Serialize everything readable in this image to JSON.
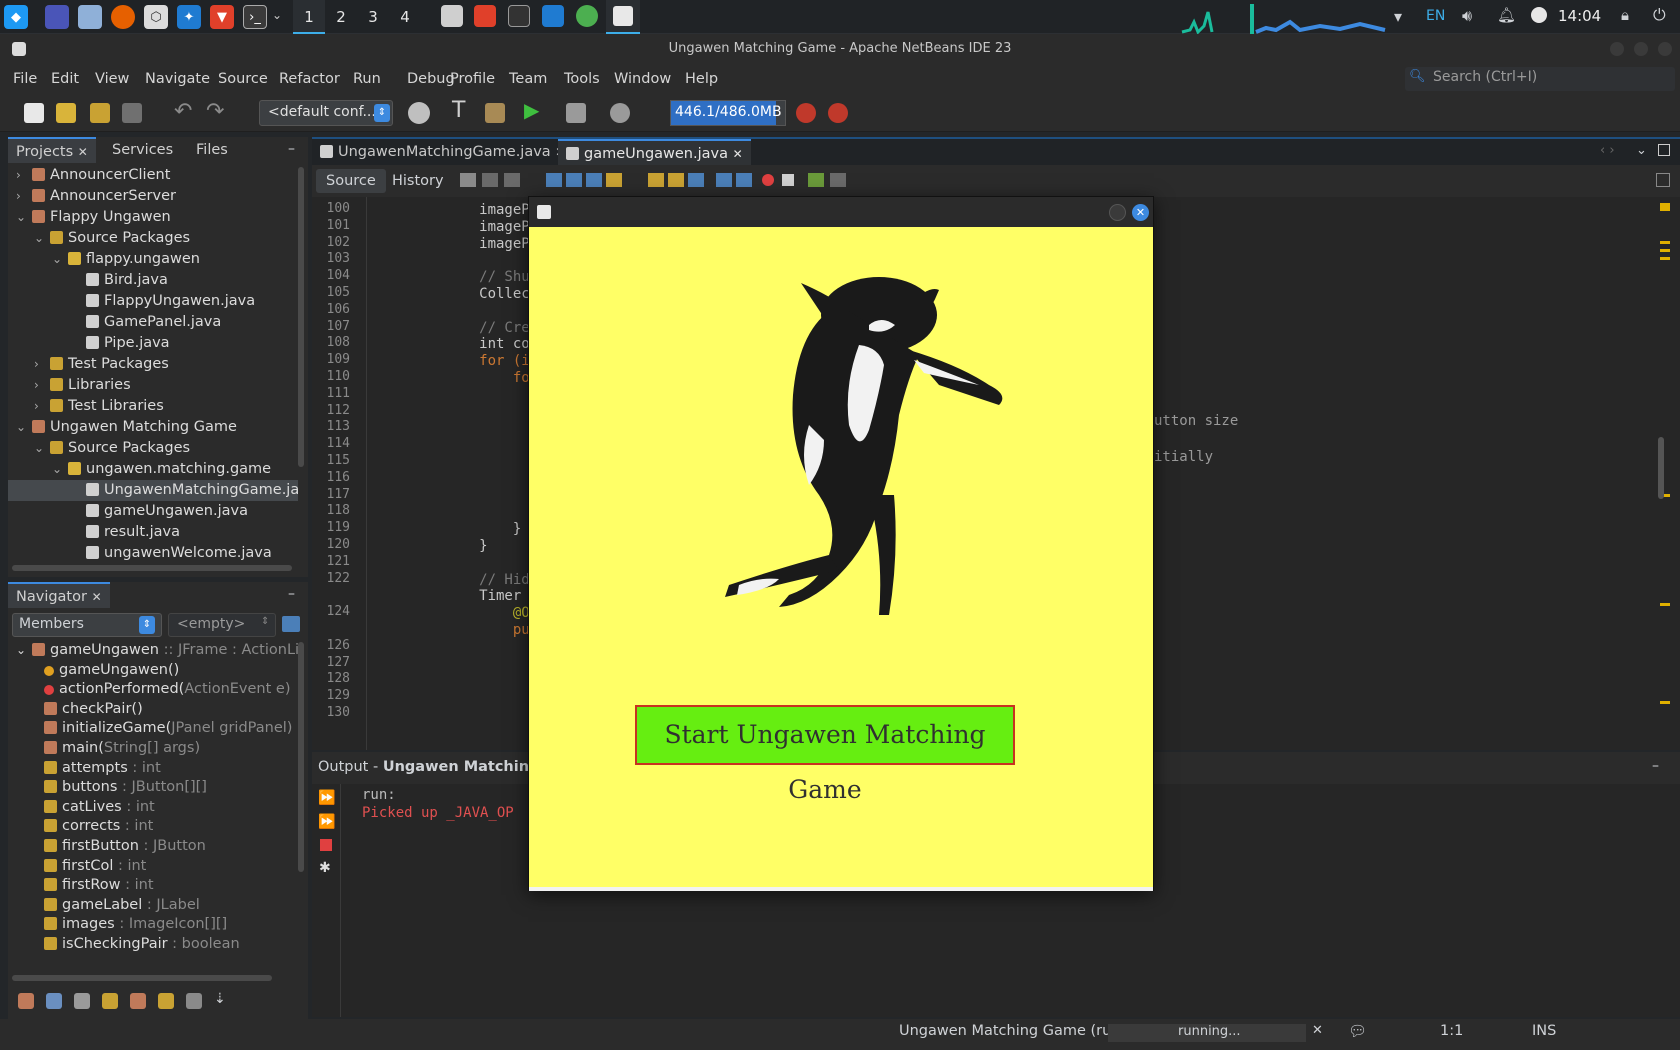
{
  "taskbar": {
    "workspaces": [
      "1",
      "2",
      "3",
      "4"
    ],
    "lang": "EN",
    "clock": "14:04"
  },
  "window": {
    "title": "Ungawen Matching Game - Apache NetBeans IDE 23"
  },
  "menu": [
    "File",
    "Edit",
    "View",
    "Navigate",
    "Source",
    "Refactor",
    "Run",
    "Debug",
    "Profile",
    "Team",
    "Tools",
    "Window",
    "Help"
  ],
  "search": {
    "placeholder": "Search (Ctrl+I)"
  },
  "toolbar": {
    "config": "<default conf...",
    "memory": "446.1/486.0MB",
    "memory_fraction": 0.918
  },
  "projects": {
    "tabs": [
      "Projects",
      "Services",
      "Files"
    ],
    "rows": [
      {
        "label": "AnnouncerClient",
        "level": 0,
        "arrow": "›",
        "icon": "project"
      },
      {
        "label": "AnnouncerServer",
        "level": 0,
        "arrow": "›",
        "icon": "project"
      },
      {
        "label": "Flappy Ungawen",
        "level": 0,
        "arrow": "⌄",
        "icon": "project"
      },
      {
        "label": "Source Packages",
        "level": 1,
        "arrow": "⌄",
        "icon": "folder"
      },
      {
        "label": "flappy.ungawen",
        "level": 2,
        "arrow": "⌄",
        "icon": "package"
      },
      {
        "label": "Bird.java",
        "level": 3,
        "arrow": "",
        "icon": "java"
      },
      {
        "label": "FlappyUngawen.java",
        "level": 3,
        "arrow": "",
        "icon": "java"
      },
      {
        "label": "GamePanel.java",
        "level": 3,
        "arrow": "",
        "icon": "java"
      },
      {
        "label": "Pipe.java",
        "level": 3,
        "arrow": "",
        "icon": "java"
      },
      {
        "label": "Test Packages",
        "level": 1,
        "arrow": "›",
        "icon": "folder"
      },
      {
        "label": "Libraries",
        "level": 1,
        "arrow": "›",
        "icon": "folder"
      },
      {
        "label": "Test Libraries",
        "level": 1,
        "arrow": "›",
        "icon": "folder"
      },
      {
        "label": "Ungawen Matching Game",
        "level": 0,
        "arrow": "⌄",
        "icon": "project"
      },
      {
        "label": "Source Packages",
        "level": 1,
        "arrow": "⌄",
        "icon": "folder"
      },
      {
        "label": "ungawen.matching.game",
        "level": 2,
        "arrow": "⌄",
        "icon": "package"
      },
      {
        "label": "UngawenMatchingGame.java",
        "level": 3,
        "arrow": "",
        "icon": "java",
        "selected": true
      },
      {
        "label": "gameUngawen.java",
        "level": 3,
        "arrow": "",
        "icon": "java"
      },
      {
        "label": "result.java",
        "level": 3,
        "arrow": "",
        "icon": "java"
      },
      {
        "label": "ungawenWelcome.java",
        "level": 3,
        "arrow": "",
        "icon": "java"
      }
    ]
  },
  "navigator": {
    "title": "Navigator",
    "filter": "Members",
    "empty": "<empty>",
    "members": [
      {
        "name": "gameUngawen",
        "type": " :: JFrame : ActionListe",
        "icon": "class"
      },
      {
        "name": "gameUngawen()",
        "type": "",
        "icon": "ctor"
      },
      {
        "name": "actionPerformed(",
        "type": "ActionEvent e)",
        "icon": "method-red"
      },
      {
        "name": "checkPair()",
        "type": "",
        "icon": "method"
      },
      {
        "name": "initializeGame(",
        "type": "JPanel gridPanel)",
        "icon": "method"
      },
      {
        "name": "main(",
        "type": "String[] args)",
        "icon": "method"
      },
      {
        "name": "attempts",
        "type": " : int",
        "icon": "field"
      },
      {
        "name": "buttons",
        "type": " : JButton[][]",
        "icon": "field"
      },
      {
        "name": "catLives",
        "type": " : int",
        "icon": "field"
      },
      {
        "name": "corrects",
        "type": " : int",
        "icon": "field"
      },
      {
        "name": "firstButton",
        "type": " : JButton",
        "icon": "field"
      },
      {
        "name": "firstCol",
        "type": " : int",
        "icon": "field"
      },
      {
        "name": "firstRow",
        "type": " : int",
        "icon": "field"
      },
      {
        "name": "gameLabel",
        "type": " : JLabel",
        "icon": "field"
      },
      {
        "name": "images",
        "type": " : ImageIcon[][]",
        "icon": "field"
      },
      {
        "name": "isCheckingPair",
        "type": " : boolean",
        "icon": "field"
      }
    ]
  },
  "editor": {
    "tabs": [
      "UngawenMatchingGame.java",
      "gameUngawen.java"
    ],
    "active_tab": 1,
    "subtabs": [
      "Source",
      "History"
    ],
    "lines": [
      {
        "n": "100",
        "code": "            imagePai",
        "cls": "tx"
      },
      {
        "n": "101",
        "code": "            imagePai",
        "cls": "tx"
      },
      {
        "n": "102",
        "code": "            imagePai",
        "cls": "tx"
      },
      {
        "n": "103",
        "code": "",
        "cls": "tx"
      },
      {
        "n": "104",
        "code": "            // Shuf",
        "cls": "cm"
      },
      {
        "n": "105",
        "code": "            Collecti",
        "cls": "tx"
      },
      {
        "n": "106",
        "code": "",
        "cls": "tx"
      },
      {
        "n": "107",
        "code": "            // Creat",
        "cls": "cm"
      },
      {
        "n": "108",
        "code": "            int cour",
        "cls": "tx"
      },
      {
        "n": "109",
        "code": "            for (int",
        "cls": "kw"
      },
      {
        "n": "110",
        "code": "                for",
        "cls": "kw"
      },
      {
        "n": "111",
        "code": "",
        "cls": "tx"
      },
      {
        "n": "112",
        "code": "",
        "cls": "tx"
      },
      {
        "n": "113",
        "code": "",
        "cls": "tx"
      },
      {
        "n": "114",
        "code": "",
        "cls": "tx"
      },
      {
        "n": "115",
        "code": "",
        "cls": "tx"
      },
      {
        "n": "116",
        "code": "",
        "cls": "tx"
      },
      {
        "n": "117",
        "code": "",
        "cls": "tx"
      },
      {
        "n": "118",
        "code": "",
        "cls": "tx"
      },
      {
        "n": "119",
        "code": "                }",
        "cls": "tx"
      },
      {
        "n": "120",
        "code": "            }",
        "cls": "tx"
      },
      {
        "n": "121",
        "code": "",
        "cls": "tx"
      },
      {
        "n": "122",
        "code": "            // Hide",
        "cls": "cm"
      },
      {
        "n": "",
        "code": "            Timer ti",
        "cls": "tx"
      },
      {
        "n": "124",
        "code": "                @Ove",
        "cls": "an"
      },
      {
        "n": "",
        "code": "                publ",
        "cls": "kw"
      },
      {
        "n": "126",
        "code": "",
        "cls": "tx"
      },
      {
        "n": "127",
        "code": "",
        "cls": "tx"
      },
      {
        "n": "128",
        "code": "",
        "cls": "tx"
      },
      {
        "n": "129",
        "code": "",
        "cls": "tx"
      },
      {
        "n": "130",
        "code": "",
        "cls": "tx"
      }
    ],
    "right_fragments": [
      "utton size",
      "itially"
    ]
  },
  "output": {
    "title": "Output - ",
    "project": "Ungawen Matching G",
    "lines": [
      "run:",
      "Picked up _JAVA_OP"
    ]
  },
  "game": {
    "button": "Start Ungawen Matching Game",
    "bg": "#ffff66",
    "button_bg": "#66ee11"
  },
  "status": {
    "task": "Ungawen Matching Game (run)",
    "progress": "running...",
    "pos": "1:1",
    "mode": "INS"
  },
  "colors": {
    "accent": "#3d8ae0",
    "memory": "#2f6fc4"
  }
}
